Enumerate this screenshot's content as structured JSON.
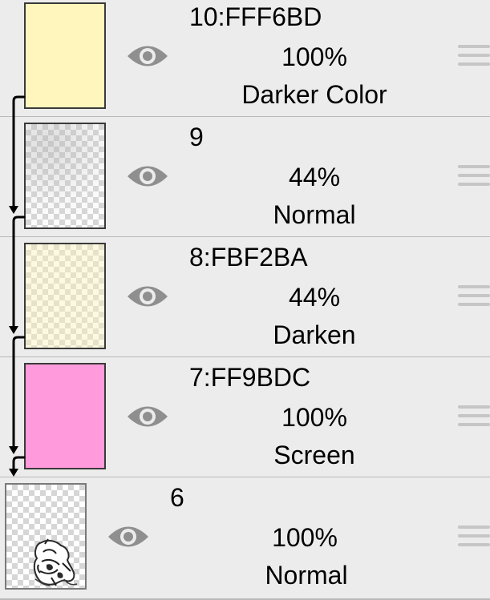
{
  "layers": [
    {
      "name": "10:FFF6BD",
      "opacity": "100%",
      "blend": "Darker Color",
      "visible": true,
      "fill": "#FFF6BD",
      "clipped": true
    },
    {
      "name": "9",
      "opacity": "44%",
      "blend": "Normal",
      "visible": true,
      "fill": "texture",
      "clipped": true
    },
    {
      "name": "8:FBF2BA",
      "opacity": "44%",
      "blend": "Darken",
      "visible": true,
      "fill": "#FBF2BA",
      "clipped": true
    },
    {
      "name": "7:FF9BDC",
      "opacity": "100%",
      "blend": "Screen",
      "visible": true,
      "fill": "#FF9BDC",
      "clipped": true
    },
    {
      "name": "6",
      "opacity": "100%",
      "blend": "Normal",
      "visible": true,
      "fill": "artwork",
      "clipped": false
    }
  ],
  "colors": {
    "background": "#ececec",
    "eye_icon": "#8f8f8f",
    "handle": "#c6c6c6",
    "clip_arrow": "#000000"
  },
  "icons": {
    "visibility": "eye-icon",
    "reorder": "drag-handle-icon",
    "clipping": "clipping-arrow-icon"
  }
}
